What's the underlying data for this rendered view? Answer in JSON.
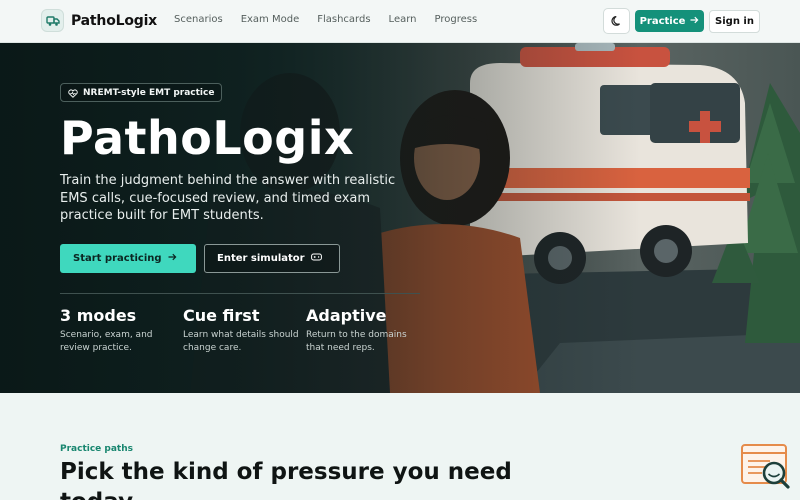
{
  "nav": {
    "brand": "PathoLogix",
    "links": [
      "Scenarios",
      "Exam Mode",
      "Flashcards",
      "Learn",
      "Progress"
    ],
    "theme_icon": "moon-icon",
    "practice_label": "Practice",
    "signin_label": "Sign in"
  },
  "hero": {
    "badge": "NREMT-style EMT practice",
    "title": "PathoLogix",
    "description": "Train the judgment behind the answer with realistic EMS calls, cue-focused review, and timed exam practice built for EMT students.",
    "primary_cta": "Start practicing",
    "secondary_cta": "Enter simulator",
    "stats": [
      {
        "title": "3 modes",
        "desc": "Scenario, exam, and review practice."
      },
      {
        "title": "Cue first",
        "desc": "Learn what details should change care."
      },
      {
        "title": "Adaptive",
        "desc": "Return to the domains that need reps."
      }
    ]
  },
  "section": {
    "kicker": "Practice paths",
    "title": "Pick the kind of pressure you need today"
  },
  "colors": {
    "accent": "#14917a",
    "cta": "#3fd8be",
    "kicker": "#18866f"
  }
}
